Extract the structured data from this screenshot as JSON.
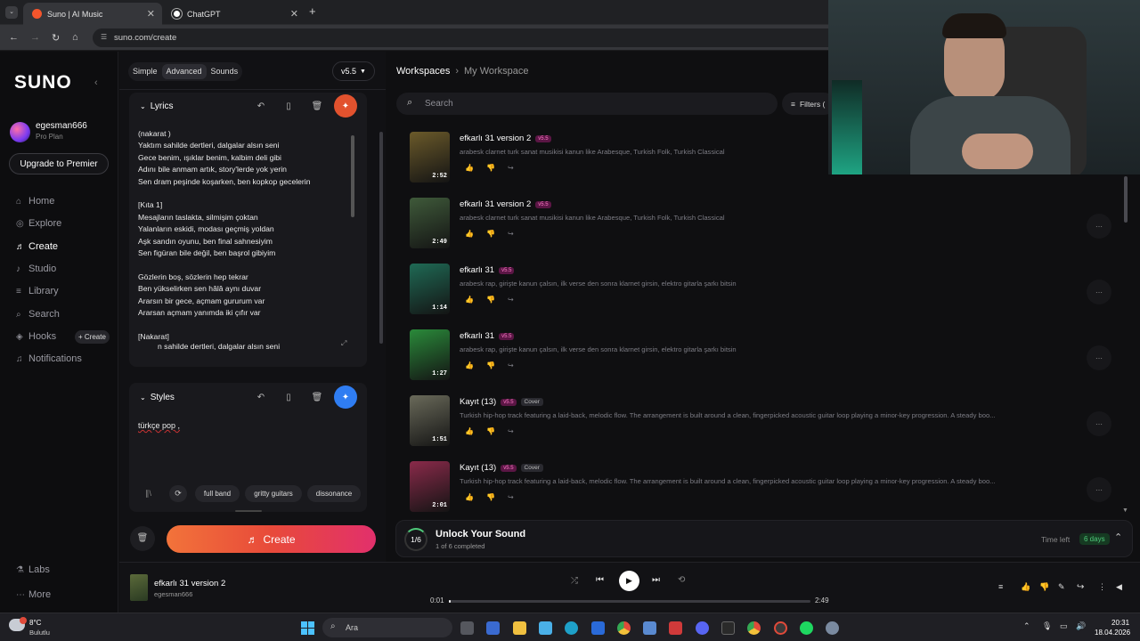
{
  "browser": {
    "tabs": [
      {
        "title": "Suno | AI Music",
        "active": true,
        "dot_color": "#f3552c"
      },
      {
        "title": "ChatGPT",
        "active": false,
        "dot_color": "#ffffff"
      }
    ],
    "url": "suno.com/create"
  },
  "sidebar": {
    "logo": "SUNO",
    "user": {
      "name": "egesman666",
      "plan": "Pro Plan"
    },
    "upgrade_label": "Upgrade to Premier",
    "nav": [
      {
        "label": "Home",
        "icon": "home-icon"
      },
      {
        "label": "Explore",
        "icon": "explore-icon"
      },
      {
        "label": "Create",
        "icon": "create-icon",
        "active": true
      },
      {
        "label": "Studio",
        "icon": "studio-icon"
      },
      {
        "label": "Library",
        "icon": "library-icon"
      },
      {
        "label": "Search",
        "icon": "search-icon"
      },
      {
        "label": "Hooks",
        "icon": "hooks-icon"
      },
      {
        "label": "Notifications",
        "icon": "bell-icon"
      }
    ],
    "hooks_create": "+ Create",
    "bottom": [
      {
        "label": "Labs"
      },
      {
        "label": "More"
      }
    ]
  },
  "create_panel": {
    "modes": [
      "Simple",
      "Advanced",
      "Sounds"
    ],
    "active_mode": "Advanced",
    "version": "v5.5",
    "lyrics_title": "Lyrics",
    "lyrics_text": "(nakarat )\nYaktım sahilde dertleri, dalgalar alsın seni\nGece benim, ışıklar benim, kalbim deli gibi\nAdını bile anmam artık, story'lerde yok yerin\nSen dram peşinde koşarken, ben kopkop gecelerin\n\n[Kıta 1]\nMesajların taslakta, silmişim çoktan\nYalanların eskidi, modası geçmiş yoldan\nAşk sandın oyunu, ben final sahnesiyim\nSen figüran bile değil, ben başrol gibiyim\n\nGözlerin boş, sözlerin hep tekrar\nBen yükselirken sen hâlâ aynı duvar\nArarsın bir gece, açmam gururum var\nArarsan açmam yanımda iki çıfır var\n\n[Nakarat]",
    "lyrics_last_line": "n sahilde dertleri, dalgalar alsın seni",
    "styles_title": "Styles",
    "styles_text": "türkçe pop ,",
    "style_chips": [
      "full band",
      "gritty guitars",
      "dissonance"
    ],
    "create_label": "Create",
    "accent": "#e84a3a"
  },
  "workspace": {
    "breadcrumb_root": "Workspaces",
    "breadcrumb_current": "My Workspace",
    "search_placeholder": "Search",
    "filters_label": "Filters (",
    "songs": [
      {
        "title": "efkarlı 31 version 2",
        "badge": "v5.5",
        "cover": "",
        "desc": "arabesk clarnet turk sanat musikisi kanun like Arabesque, Turkish Folk, Turkish Classical",
        "duration": "2:52",
        "thumb": "#6b5a2a"
      },
      {
        "title": "efkarlı 31 version 2",
        "badge": "v5.5",
        "cover": "",
        "desc": "arabesk clarnet turk sanat musikisi kanun like Arabesque, Turkish Folk, Turkish Classical",
        "duration": "2:49",
        "thumb": "#3f5a3a"
      },
      {
        "title": "efkarlı 31",
        "badge": "v5.5",
        "cover": "",
        "desc": "arabesk rap, girişte kanun çalsın, ilk verse den sonra klarnet girsin, elektro gitarla şarkı bitsin",
        "duration": "1:14",
        "thumb": "#1f6a55"
      },
      {
        "title": "efkarlı 31",
        "badge": "v5.5",
        "cover": "",
        "desc": "arabesk rap, girişte kanun çalsın, ilk verse den sonra klarnet girsin, elektro gitarla şarkı bitsin",
        "duration": "1:27",
        "thumb": "#2a8a3a"
      },
      {
        "title": "Kayıt (13)",
        "badge": "v5.5",
        "cover": "Cover",
        "desc": "Turkish hip-hop track featuring a laid-back, melodic flow. The arrangement is built around a clean, fingerpicked acoustic guitar loop playing a minor-key progression. A steady boo...",
        "duration": "1:51",
        "thumb": "#6a6a5a"
      },
      {
        "title": "Kayıt (13)",
        "badge": "v5.5",
        "cover": "Cover",
        "desc": "Turkish hip-hop track featuring a laid-back, melodic flow. The arrangement is built around a clean, fingerpicked acoustic guitar loop playing a minor-key progression. A steady boo...",
        "duration": "2:01",
        "thumb": "#8a2a4a"
      }
    ],
    "unlock": {
      "progress": "1/6",
      "title": "Unlock Your Sound",
      "subtitle": "1 of 6 completed",
      "time_left_label": "Time left",
      "time_left_value": "6 days"
    }
  },
  "player": {
    "title": "efkarlı 31 version 2",
    "artist": "egesman666",
    "current": "0:01",
    "total": "2:49",
    "progress_fraction": 0.006
  },
  "taskbar": {
    "weather_temp": "8°C",
    "weather_desc": "Bulutlu",
    "search_label": "Ara",
    "time": "20:31",
    "date": "18.04.2026"
  }
}
